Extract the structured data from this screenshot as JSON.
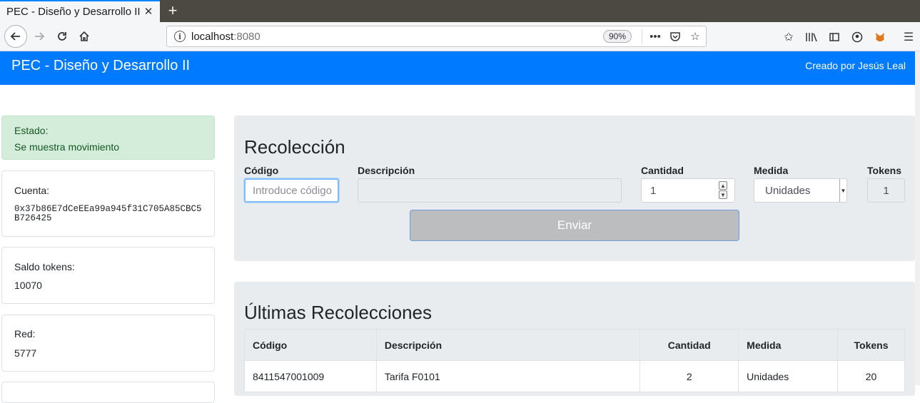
{
  "browser": {
    "tab_title": "PEC - Diseño y Desarrollo II",
    "url_host": "localhost",
    "url_port": ":8080",
    "zoom": "90%"
  },
  "header": {
    "title": "PEC - Diseño y Desarrollo II",
    "credit": "Creado por Jesús Leal"
  },
  "sidebar": {
    "status_label": "Estado:",
    "status_value": "Se muestra movimiento",
    "account_label": "Cuenta:",
    "account_value": "0x37b86E7dCeEEa99a945f31C705A85CBC5B726425",
    "balance_label": "Saldo tokens:",
    "balance_value": "10070",
    "network_label": "Red:",
    "network_value": "5777"
  },
  "form": {
    "title": "Recolección",
    "code_label": "Código",
    "code_placeholder": "Introduce código",
    "description_label": "Descripción",
    "quantity_label": "Cantidad",
    "quantity_value": "1",
    "measure_label": "Medida",
    "measure_value": "Unidades",
    "tokens_label": "Tokens",
    "tokens_value": "1",
    "submit_label": "Enviar"
  },
  "recent": {
    "title": "Últimas Recolecciones",
    "columns": [
      "Código",
      "Descripción",
      "Cantidad",
      "Medida",
      "Tokens"
    ],
    "rows": [
      [
        "8411547001009",
        "Tarifa F0101",
        "2",
        "Unidades",
        "20"
      ]
    ]
  },
  "colors": {
    "accent": "#007bff",
    "status_bg": "#d4edda",
    "status_text": "#155724",
    "panel_bg": "#e9ecef"
  }
}
